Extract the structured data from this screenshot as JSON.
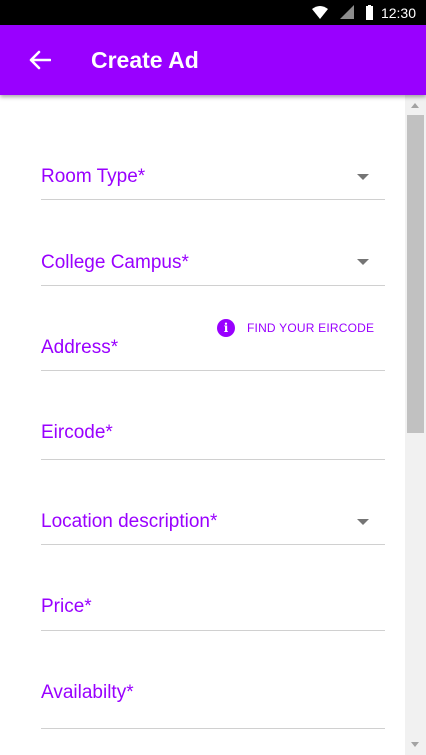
{
  "status_bar": {
    "time": "12:30",
    "icons": [
      "wifi-icon",
      "signal-icon",
      "battery-icon"
    ]
  },
  "app_bar": {
    "title": "Create Ad",
    "back_icon": "arrow-left-icon",
    "background_color": "#9900ff"
  },
  "form": {
    "fields": [
      {
        "label": "Room Type*",
        "kind": "dropdown"
      },
      {
        "label": "College Campus*",
        "kind": "dropdown"
      },
      {
        "label": "Address*",
        "kind": "text"
      },
      {
        "label": "Eircode*",
        "kind": "text"
      },
      {
        "label": "Location description*",
        "kind": "dropdown"
      },
      {
        "label": "Price*",
        "kind": "text"
      },
      {
        "label": "Availabilty*",
        "kind": "text"
      }
    ],
    "eircode_link": {
      "label": "FIND YOUR EIRCODE",
      "icon": "info-icon",
      "icon_text": "i"
    }
  },
  "colors": {
    "accent": "#9900ff",
    "divider": "#d0d0d0",
    "arrow": "#757575"
  }
}
